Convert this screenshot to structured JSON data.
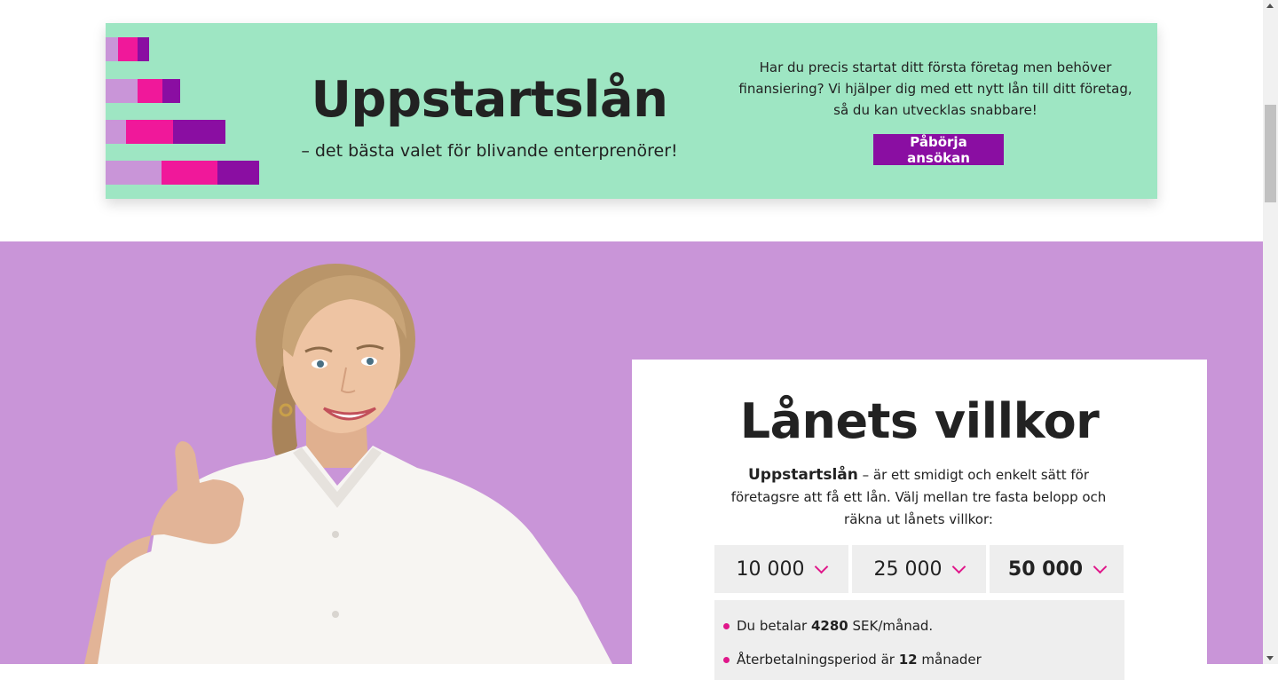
{
  "banner": {
    "title": "Uppstartslån",
    "subtitle": "– det bästa valet för blivande enterprenörer!",
    "description": "Har du precis startat ditt första företag men behöver finansiering? Vi hjälper dig med ett nytt lån till ditt företag, så du kan utvecklas snabbare!",
    "apply_button": "Påbörja ansökan"
  },
  "colors": {
    "banner_bg": "#9ee6c3",
    "hero_bg": "#c995d8",
    "accent_purple": "#8a0ea2",
    "accent_pink": "#e0178a",
    "light_purple": "#c995d8"
  },
  "card": {
    "title": "Lånets villkor",
    "desc_bold": "Uppstartslån",
    "desc_rest": " – är ett smidigt och enkelt sätt för företagsre att få ett lån. Välj mellan tre fasta belopp och räkna ut lånets villkor:",
    "amounts": [
      {
        "label": "10 000",
        "selected": false
      },
      {
        "label": "25 000",
        "selected": false
      },
      {
        "label": "50 000",
        "selected": true
      }
    ],
    "info": {
      "row1_prefix": "Du betalar ",
      "row1_value": "4280",
      "row1_suffix": " SEK/månad.",
      "row2_prefix": "Återbetalningsperiod är ",
      "row2_value": "12",
      "row2_suffix": " månader"
    }
  },
  "hero": {
    "image_alt": "Smiling woman giving thumbs up"
  }
}
